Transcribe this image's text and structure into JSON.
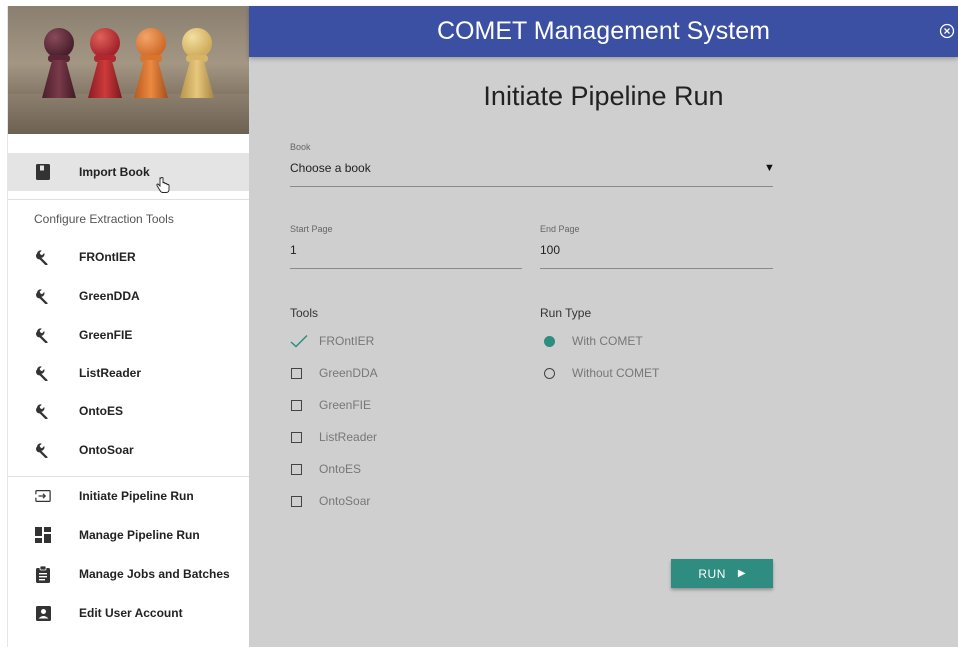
{
  "app": {
    "title": "COMET Management System",
    "accent_color": "#3b4fa3",
    "primary_color": "#2e8c80"
  },
  "sidebar": {
    "import": {
      "label": "Import Book",
      "icon": "book-icon",
      "active": true
    },
    "section_title": "Configure Extraction Tools",
    "tools": [
      {
        "label": "FROntIER",
        "icon": "wrench-icon"
      },
      {
        "label": "GreenDDA",
        "icon": "wrench-icon"
      },
      {
        "label": "GreenFIE",
        "icon": "wrench-icon"
      },
      {
        "label": "ListReader",
        "icon": "wrench-icon"
      },
      {
        "label": "OntoES",
        "icon": "wrench-icon"
      },
      {
        "label": "OntoSoar",
        "icon": "wrench-icon"
      }
    ],
    "bottom": [
      {
        "label": "Initiate Pipeline Run",
        "icon": "input-arrow-icon"
      },
      {
        "label": "Manage Pipeline Run",
        "icon": "dashboard-icon"
      },
      {
        "label": "Manage Jobs and Batches",
        "icon": "clipboard-icon"
      },
      {
        "label": "Edit User Account",
        "icon": "account-box-icon"
      }
    ]
  },
  "page": {
    "title": "Initiate Pipeline Run",
    "book": {
      "label": "Book",
      "value": "Choose a book"
    },
    "start_page": {
      "label": "Start Page",
      "value": "1"
    },
    "end_page": {
      "label": "End Page",
      "value": "100"
    },
    "tools_title": "Tools",
    "tools": [
      {
        "label": "FROntIER",
        "checked": true
      },
      {
        "label": "GreenDDA",
        "checked": false
      },
      {
        "label": "GreenFIE",
        "checked": false
      },
      {
        "label": "ListReader",
        "checked": false
      },
      {
        "label": "OntoES",
        "checked": false
      },
      {
        "label": "OntoSoar",
        "checked": false
      }
    ],
    "run_type_title": "Run Type",
    "run_types": [
      {
        "label": "With COMET",
        "selected": true
      },
      {
        "label": "Without COMET",
        "selected": false
      }
    ],
    "run_button": "RUN"
  }
}
